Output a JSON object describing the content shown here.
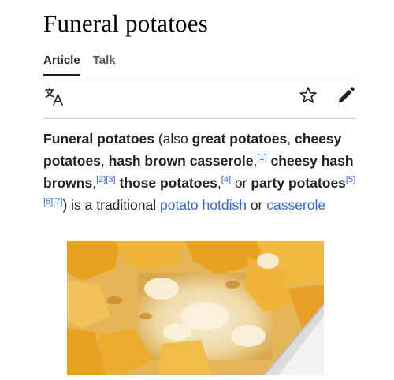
{
  "article": {
    "title": "Funeral potatoes",
    "tabs": [
      {
        "label": "Article",
        "active": true
      },
      {
        "label": "Talk",
        "active": false
      }
    ],
    "toolbar": {
      "icons": [
        "language-icon",
        "star-icon",
        "pencil-icon"
      ]
    },
    "intro": {
      "lead_bold": "Funeral potatoes",
      "t1": " (also ",
      "b1": "great potatoes",
      "t2": ", ",
      "b2": "cheesy potatoes",
      "t3": ", ",
      "b3": "hash brown casserole",
      "t4": ",",
      "ref1": "[1]",
      "t5": " ",
      "b4": "cheesy hash browns",
      "t6": ",",
      "ref2": "[2]",
      "ref3": "[3]",
      "t7": " ",
      "b5": "those potatoes",
      "t8": ",",
      "ref4": "[4]",
      "t9": " or ",
      "b6": "party potatoes",
      "ref5": "[5]",
      "ref6": "[6]",
      "ref7": "[7]",
      "t10": ") is a traditional ",
      "link1": "potato hotdish",
      "t11": " or ",
      "link2": "casserole"
    },
    "colors": {
      "link": "#3366cc",
      "text": "#202122",
      "divider": "#c8ccd1"
    }
  }
}
